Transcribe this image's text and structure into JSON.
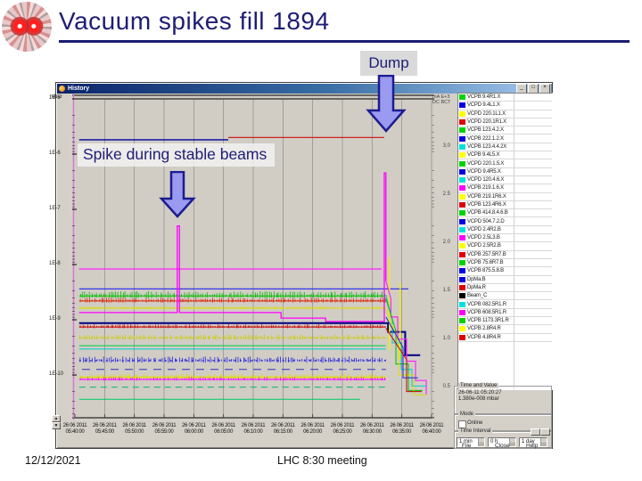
{
  "slide": {
    "title": "Vacuum spikes fill 1894",
    "date": "12/12/2021",
    "footer": "LHC 8:30 meeting"
  },
  "annotations": {
    "dump_label": "Dump",
    "spike_label": "Spike during stable beams"
  },
  "colors": {
    "accent_navy": "#1d1d75",
    "arrow_fill": "#9a9af0",
    "arrow_stroke": "#1c1c8e",
    "titlebar_from": "#0a246a",
    "titlebar_to": "#a6caf0",
    "window_bg": "#d4d0c8",
    "plot_bg": "#d1cdc5"
  },
  "window": {
    "title": "History",
    "controls": {
      "minimize": "_",
      "maximize": "□",
      "close": "×"
    },
    "time_value_group": {
      "label": "Time and Value",
      "time": "26-06-11  05:20:27",
      "value": "1.380e-008 mbar"
    },
    "mode_group": {
      "label": "Mode",
      "checkbox_label": "Online",
      "checked": false
    },
    "interval_group": {
      "label": "Time Interval",
      "fields": [
        "1 min",
        "0 h",
        "1 day"
      ]
    },
    "bottom_buttons": [
      "File",
      "Close",
      "Help"
    ]
  },
  "chart_data": {
    "type": "line",
    "title": "History",
    "ylabel": "mbar",
    "y_scale": "log",
    "y_ticks": [
      "1E-5",
      "1E-6",
      "1E-7",
      "1E-8",
      "1E-9",
      "1E-10"
    ],
    "ylim_exponents": [
      -5,
      -11
    ],
    "x_date": "26 06 2011",
    "x_times": [
      "05:40:00",
      "05:45:00",
      "05:50:00",
      "05:55:00",
      "06:00:00",
      "06:05:00",
      "06:10:00",
      "06:15:00",
      "06:20:00",
      "06:25:00",
      "06:30:00",
      "06:35:00",
      "06:40:00"
    ],
    "right_axis": {
      "unit_line1": "mA E+3",
      "unit_line2": "DC BCT",
      "ticks": [
        "3.0",
        "2.5",
        "2.0",
        "1.5",
        "1.0",
        "0.5"
      ]
    },
    "grid": "vertical",
    "legend_position": "right",
    "legend": [
      {
        "name": "VCPB 9.4R1.X",
        "color": "#00d200"
      },
      {
        "name": "VCPD 9.4L1.X",
        "color": "#0000e0"
      },
      {
        "name": "VCPD 220.1L1.X",
        "color": "#ffff00"
      },
      {
        "name": "VCPD 220.1R1.X",
        "color": "#e00000"
      },
      {
        "name": "VCPB 123.4.2.X",
        "color": "#00d200"
      },
      {
        "name": "VCPB 222.1.2.X",
        "color": "#0000e0"
      },
      {
        "name": "VCPB 123.4.4.2X",
        "color": "#00e0e0"
      },
      {
        "name": "VCPB 9.4L5.X",
        "color": "#ffff00"
      },
      {
        "name": "VCPD 220.1.5.X",
        "color": "#00d200"
      },
      {
        "name": "VCPD 9.4R5.X",
        "color": "#0000e0"
      },
      {
        "name": "VCPD 120.4.6.X",
        "color": "#00e0e0"
      },
      {
        "name": "VCPB 219.1.6.X",
        "color": "#ff00ff"
      },
      {
        "name": "VCPB 219.1R6.X",
        "color": "#ffff00"
      },
      {
        "name": "VCPB 123.4R6.X",
        "color": "#e00000"
      },
      {
        "name": "VCPB 414.8.4.6.B",
        "color": "#00d200"
      },
      {
        "name": "VCPD 504.7.2.D",
        "color": "#0000e0"
      },
      {
        "name": "VCPD 2.4R2.B",
        "color": "#00e0e0"
      },
      {
        "name": "VCPD 2.5L3.B",
        "color": "#ff00ff"
      },
      {
        "name": "VCPD 2.5R2.B",
        "color": "#ffff00"
      },
      {
        "name": "VCPB 257.5R7.B",
        "color": "#e00000"
      },
      {
        "name": "VCPB 75.6R7.B",
        "color": "#00d200"
      },
      {
        "name": "VCPB 875.5.8.B",
        "color": "#0000e0"
      },
      {
        "name": "DpMa.B",
        "color": "#0000e0"
      },
      {
        "name": "DpMa.R",
        "color": "#e00000"
      },
      {
        "name": "Beam_C",
        "color": "#000000"
      },
      {
        "name": "VCPB 082.5R1.R",
        "color": "#00e0e0"
      },
      {
        "name": "VCPB 608.5R1.R",
        "color": "#ff00ff"
      },
      {
        "name": "VCPB 1173.3R1.R",
        "color": "#00d200"
      },
      {
        "name": "VCPB 2.8R4.R",
        "color": "#ffff00"
      },
      {
        "name": "VCPB 4.8R4.R",
        "color": "#e00000"
      }
    ],
    "events": [
      {
        "label": "Spike during stable beams",
        "time_fraction": 0.29
      },
      {
        "label": "Dump",
        "time_fraction": 0.8675
      }
    ],
    "traces": [
      {
        "color": "#00009c",
        "width": 1.4,
        "pts": [
          [
            0.012,
            5.74
          ],
          [
            0.43,
            5.74
          ]
        ]
      },
      {
        "color": "#cc2222",
        "width": 1.2,
        "pts": [
          [
            0.43,
            5.7
          ],
          [
            0.867,
            5.7
          ]
        ]
      },
      {
        "color": "#ff22ff",
        "width": 1.3,
        "pts": [
          [
            0.012,
            8.08
          ],
          [
            0.86,
            8.08
          ]
        ]
      },
      {
        "color": "#2222ee",
        "width": 1.2,
        "pts": [
          [
            0.012,
            8.44
          ],
          [
            0.935,
            8.44
          ]
        ]
      },
      {
        "color": "#00bb00",
        "width": 1,
        "noise": 0.07,
        "pts": [
          [
            0.012,
            8.57
          ],
          [
            0.872,
            8.57
          ]
        ]
      },
      {
        "color": "#dd2200",
        "width": 1,
        "noise": 0.05,
        "pts": [
          [
            0.012,
            8.66
          ],
          [
            0.872,
            8.66
          ]
        ]
      },
      {
        "color": "#dddd00",
        "width": 1.1,
        "noise": 0.03,
        "pts": [
          [
            0.012,
            8.79
          ],
          [
            0.872,
            8.79
          ]
        ]
      },
      {
        "color": "#ff00ff",
        "width": 1.3,
        "pts": [
          [
            0.012,
            8.87
          ],
          [
            0.287,
            8.87
          ],
          [
            0.287,
            7.3
          ],
          [
            0.293,
            7.3
          ],
          [
            0.293,
            8.87
          ],
          [
            0.578,
            8.87
          ],
          [
            0.578,
            8.97
          ],
          [
            0.703,
            8.97
          ],
          [
            0.703,
            9.03
          ],
          [
            0.8675,
            9.03
          ],
          [
            0.8675,
            6.34
          ],
          [
            0.872,
            6.34
          ],
          [
            0.872,
            8.3
          ]
        ]
      },
      {
        "color": "#000080",
        "width": 2,
        "pts": [
          [
            0.012,
            9.06
          ],
          [
            0.878,
            9.06
          ],
          [
            0.878,
            9.22
          ],
          [
            0.926,
            9.22
          ],
          [
            0.926,
            9.64
          ],
          [
            0.968,
            9.64
          ]
        ]
      },
      {
        "color": "#cc0000",
        "width": 1,
        "noise": 0.04,
        "pts": [
          [
            0.012,
            9.13
          ],
          [
            0.872,
            9.13
          ]
        ]
      },
      {
        "color": "#cccc00",
        "width": 1,
        "dash": "3 3",
        "noise": 0.05,
        "pts": [
          [
            0.012,
            9.33
          ],
          [
            0.872,
            9.33
          ]
        ]
      },
      {
        "color": "#00cc44",
        "width": 1,
        "pts": [
          [
            0.012,
            9.47
          ],
          [
            0.872,
            9.47
          ]
        ]
      },
      {
        "color": "#00cccc",
        "width": 1,
        "pts": [
          [
            0.012,
            9.53
          ],
          [
            0.872,
            9.53
          ]
        ]
      },
      {
        "color": "#2222dd",
        "width": 1.2,
        "dash": "2 4",
        "noise": 0.06,
        "pts": [
          [
            0.012,
            9.74
          ],
          [
            0.872,
            9.74
          ]
        ]
      },
      {
        "color": "#3333bb",
        "width": 1,
        "dash": "9 7",
        "pts": [
          [
            0.02,
            9.9
          ],
          [
            0.872,
            9.9
          ]
        ]
      },
      {
        "color": "#dddd00",
        "width": 1.2,
        "noise": 0.05,
        "pts": [
          [
            0.012,
            10.04
          ],
          [
            0.872,
            10.04
          ]
        ]
      },
      {
        "color": "#ff00ff",
        "width": 1,
        "noise": 0.035,
        "pts": [
          [
            0.012,
            10.08
          ],
          [
            0.872,
            10.08
          ]
        ]
      },
      {
        "color": "#00bb66",
        "width": 1,
        "dash": "7 5",
        "pts": [
          [
            0.012,
            10.22
          ],
          [
            0.872,
            10.22
          ]
        ]
      },
      {
        "color": "#00cc66",
        "width": 1,
        "pts": [
          [
            0.012,
            10.44
          ],
          [
            0.8,
            10.44
          ]
        ]
      },
      {
        "color": "#eeee00",
        "width": 1.4,
        "pts": [
          [
            0.882,
            7.88
          ],
          [
            0.882,
            9.55
          ]
        ]
      },
      {
        "color": "#eeee00",
        "width": 1.4,
        "pts": [
          [
            0.912,
            8.33
          ],
          [
            0.912,
            9.72
          ]
        ]
      },
      {
        "color": "#ff22ff",
        "width": 1.2,
        "pts": [
          [
            0.872,
            8.3
          ],
          [
            0.886,
            8.62
          ],
          [
            0.886,
            8.95
          ],
          [
            0.905,
            8.95
          ],
          [
            0.905,
            9.35
          ],
          [
            0.93,
            9.35
          ],
          [
            0.93,
            9.75
          ],
          [
            0.955,
            9.75
          ],
          [
            0.955,
            10.1
          ],
          [
            0.985,
            10.1
          ],
          [
            0.985,
            10.35
          ]
        ]
      },
      {
        "color": "#00cccc",
        "width": 1,
        "pts": [
          [
            0.872,
            8.55
          ],
          [
            0.89,
            9.0
          ],
          [
            0.89,
            9.42
          ],
          [
            0.915,
            9.42
          ],
          [
            0.915,
            9.9
          ],
          [
            0.945,
            9.9
          ],
          [
            0.945,
            10.2
          ],
          [
            0.985,
            10.2
          ]
        ]
      },
      {
        "color": "#00bb00",
        "width": 1,
        "pts": [
          [
            0.872,
            8.62
          ],
          [
            0.9,
            9.2
          ],
          [
            0.9,
            9.8
          ],
          [
            0.935,
            9.8
          ],
          [
            0.935,
            10.28
          ],
          [
            0.975,
            10.28
          ]
        ]
      },
      {
        "color": "#dddd00",
        "width": 1,
        "pts": [
          [
            0.872,
            8.8
          ],
          [
            0.908,
            9.42
          ],
          [
            0.908,
            10.0
          ],
          [
            0.95,
            10.0
          ],
          [
            0.95,
            10.36
          ],
          [
            0.985,
            10.36
          ]
        ]
      },
      {
        "color": "#2222dd",
        "width": 1,
        "pts": [
          [
            0.872,
            8.95
          ],
          [
            0.92,
            9.5
          ],
          [
            0.92,
            10.05
          ],
          [
            0.962,
            10.05
          ]
        ]
      },
      {
        "color": "#cc0000",
        "width": 1,
        "pts": [
          [
            0.872,
            9.15
          ],
          [
            0.93,
            9.72
          ],
          [
            0.93,
            10.3
          ],
          [
            0.972,
            10.3
          ]
        ]
      }
    ]
  }
}
